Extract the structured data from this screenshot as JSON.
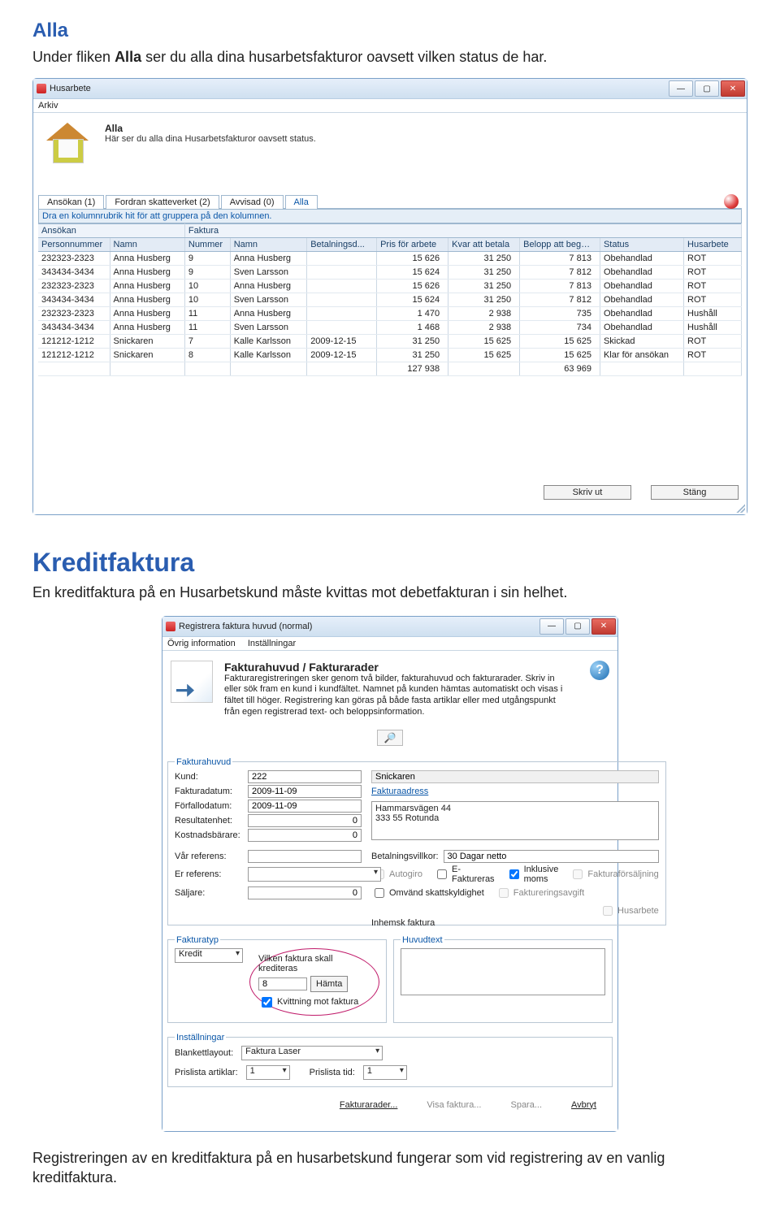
{
  "doc": {
    "heading1": "Alla",
    "para1_a": "Under fliken ",
    "para1_b": "Alla",
    "para1_c": " ser du alla dina husarbetsfakturor oavsett vilken status de har.",
    "heading2": "Kreditfaktura",
    "para2": "En kreditfaktura på en Husarbetskund måste kvittas mot debetfakturan i sin helhet.",
    "para3": "Registreringen av en kreditfaktura på en husarbetskund fungerar som vid registrering av en vanlig kreditfaktura."
  },
  "win1": {
    "title": "Husarbete",
    "menu": {
      "arkiv": "Arkiv"
    },
    "hdr_title": "Alla",
    "hdr_sub": "Här ser du alla dina Husarbetsfakturor oavsett status.",
    "tabs": [
      "Ansökan (1)",
      "Fordran skatteverket (2)",
      "Avvisad (0)",
      "Alla"
    ],
    "group_hint": "Dra en kolumnrubrik hit för att gruppera på den kolumnen.",
    "group_headers": {
      "ansokan": "Ansökan",
      "faktura": "Faktura"
    },
    "cols": [
      "Personnummer",
      "Namn",
      "Nummer",
      "Namn",
      "Betalningsd...",
      "Pris för arbete",
      "Kvar att betala",
      "Belopp att begära",
      "Status",
      "Husarbete"
    ],
    "rows": [
      [
        "232323-2323",
        "Anna Husberg",
        "9",
        "Anna Husberg",
        "",
        "15 626",
        "31 250",
        "7 813",
        "Obehandlad",
        "ROT"
      ],
      [
        "343434-3434",
        "Anna Husberg",
        "9",
        "Sven Larsson",
        "",
        "15 624",
        "31 250",
        "7 812",
        "Obehandlad",
        "ROT"
      ],
      [
        "232323-2323",
        "Anna Husberg",
        "10",
        "Anna Husberg",
        "",
        "15 626",
        "31 250",
        "7 813",
        "Obehandlad",
        "ROT"
      ],
      [
        "343434-3434",
        "Anna Husberg",
        "10",
        "Sven Larsson",
        "",
        "15 624",
        "31 250",
        "7 812",
        "Obehandlad",
        "ROT"
      ],
      [
        "232323-2323",
        "Anna Husberg",
        "11",
        "Anna Husberg",
        "",
        "1 470",
        "2 938",
        "735",
        "Obehandlad",
        "Hushåll"
      ],
      [
        "343434-3434",
        "Anna Husberg",
        "11",
        "Sven Larsson",
        "",
        "1 468",
        "2 938",
        "734",
        "Obehandlad",
        "Hushåll"
      ],
      [
        "121212-1212",
        "Snickaren",
        "7",
        "Kalle Karlsson",
        "2009-12-15",
        "31 250",
        "15 625",
        "15 625",
        "Skickad",
        "ROT"
      ],
      [
        "121212-1212",
        "Snickaren",
        "8",
        "Kalle Karlsson",
        "2009-12-15",
        "31 250",
        "15 625",
        "15 625",
        "Klar för ansökan",
        "ROT"
      ]
    ],
    "totals": {
      "pris": "127 938",
      "belopp": "63 969"
    },
    "btn_print": "Skriv ut",
    "btn_close": "Stäng"
  },
  "win2": {
    "title": "Registrera faktura huvud (normal)",
    "menu": {
      "ovrig": "Övrig information",
      "inst": "Inställningar"
    },
    "hdr_title": "Fakturahuvud / Fakturarader",
    "hdr_sub": "Fakturaregistreringen sker genom två bilder, fakturahuvud och fakturarader. Skriv in eller sök fram en kund i kundfältet. Namnet på kunden hämtas automatiskt och visas i fältet till höger. Registrering kan göras på både fasta artiklar eller med utgångspunkt från egen registrerad text- och beloppsinformation.",
    "fakturahuvud": {
      "legend": "Fakturahuvud",
      "lbl_kund": "Kund:",
      "val_kund": "222",
      "val_kundnamn": "Snickaren",
      "lbl_fdat": "Fakturadatum:",
      "val_fdat": "2009-11-09",
      "link_faddr": "Fakturaadress",
      "addr_line1": "Hammarsvägen 44",
      "addr_line2": "333 55 Rotunda",
      "lbl_forf": "Förfallodatum:",
      "val_forf": "2009-11-09",
      "lbl_res": "Resultatenhet:",
      "val_res": "0",
      "lbl_kost": "Kostnadsbärare:",
      "val_kost": "0",
      "lbl_varr": "Vår referens:",
      "lbl_err": "Er referens:",
      "lbl_salj": "Säljare:",
      "val_salj": "0",
      "lbl_betv": "Betalningsvillkor:",
      "val_betv": "30 Dagar netto",
      "cb_autogiro": "Autogiro",
      "cb_efakt": "E-Faktureras",
      "cb_inkmoms": "Inklusive moms",
      "cb_omvand": "Omvänd skattskyldighet",
      "cb_fforsalj": "Fakturaförsäljning",
      "cb_favgift": "Faktureringsavgift",
      "cb_husarb": "Husarbete",
      "txt_inhemsk": "Inhemsk faktura"
    },
    "fakturatyp": {
      "legend": "Fakturatyp",
      "val_typ": "Kredit",
      "lbl_vilken": "Vilken faktura skall krediteras",
      "val_nr": "8",
      "btn_hamta": "Hämta",
      "cb_kvitt": "Kvittning mot faktura"
    },
    "huvudtext": {
      "legend": "Huvudtext"
    },
    "installningar": {
      "legend": "Inställningar",
      "lbl_layout": "Blankettlayout:",
      "val_layout": "Faktura Laser",
      "lbl_prisart": "Prislista artiklar:",
      "val_prisart": "1",
      "lbl_pristid": "Prislista tid:",
      "val_pristid": "1"
    },
    "buttons": {
      "rader": "Fakturarader...",
      "visa": "Visa faktura...",
      "spara": "Spara...",
      "avbryt": "Avbryt"
    }
  }
}
